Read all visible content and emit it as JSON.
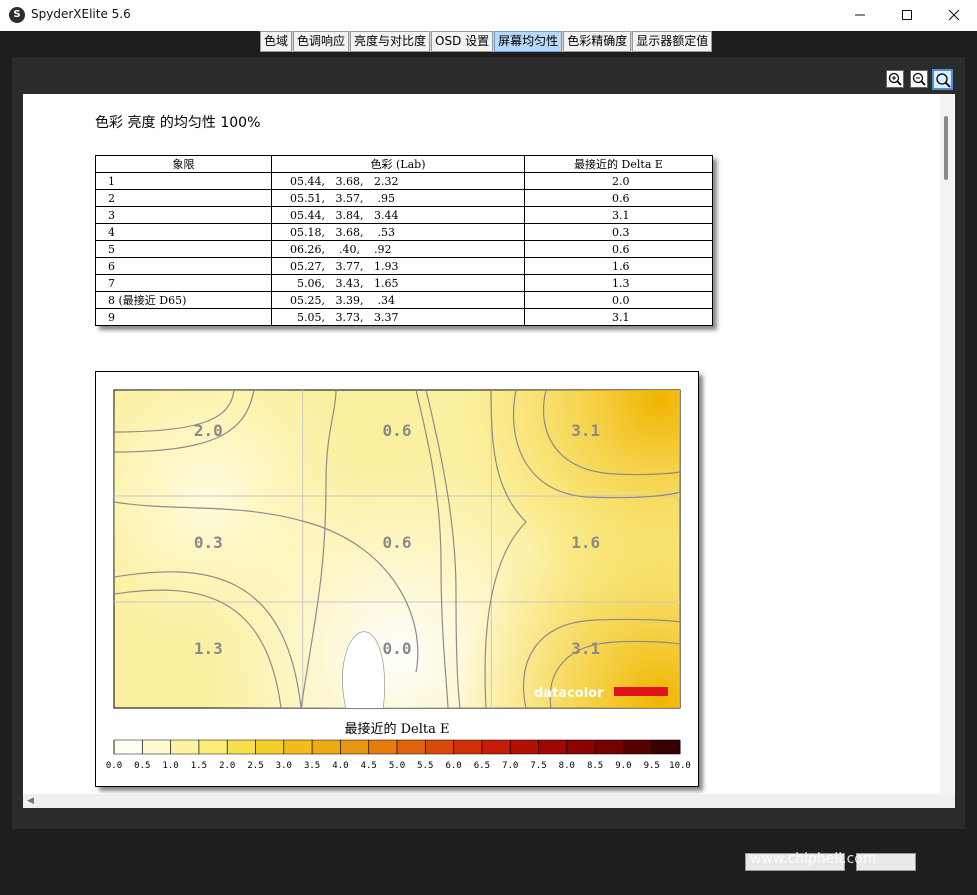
{
  "window": {
    "title": "SpyderXElite 5.6",
    "icon_letter": "S",
    "controls": [
      "minimize-icon",
      "maximize-icon",
      "close-icon"
    ]
  },
  "tabs": [
    {
      "label": "色域",
      "active": false
    },
    {
      "label": "色调响应",
      "active": false
    },
    {
      "label": "亮度与对比度",
      "active": false
    },
    {
      "label": "OSD 设置",
      "active": false
    },
    {
      "label": "屏幕均匀性",
      "active": true
    },
    {
      "label": "色彩精确度",
      "active": false
    },
    {
      "label": "显示器额定值",
      "active": false
    }
  ],
  "toolbar": {
    "icons": [
      "zoom-in-icon",
      "zoom-out-icon",
      "zoom-fit-icon"
    ]
  },
  "report": {
    "title": "色彩 亮度 的均匀性 100%",
    "table": {
      "headers": [
        "象限",
        "色彩 (Lab)",
        "最接近的 Delta E"
      ],
      "rows": [
        [
          "1",
          "05.44,   3.68,   2.32",
          "2.0"
        ],
        [
          "2",
          "05.51,   3.57,    .95",
          "0.6"
        ],
        [
          "3",
          "05.44,   3.84,   3.44",
          "3.1"
        ],
        [
          "4",
          "05.18,   3.68,    .53",
          "0.3"
        ],
        [
          "5",
          "06.26,    .40,    .92",
          "0.6"
        ],
        [
          "6",
          "05.27,   3.77,   1.93",
          "1.6"
        ],
        [
          "7",
          "  5.06,   3.43,   1.65",
          "1.3"
        ],
        [
          "8 (最接近 D65)",
          "05.25,   3.39,    .34",
          "0.0"
        ],
        [
          "9",
          "  5.05,   3.73,   3.37",
          "3.1"
        ]
      ]
    }
  },
  "chart_data": {
    "type": "heatmap",
    "title": "最接近的 Delta E",
    "grid_rows": 3,
    "grid_cols": 3,
    "cells": [
      [
        2.0,
        0.6,
        3.1
      ],
      [
        0.3,
        0.6,
        1.6
      ],
      [
        1.3,
        0.0,
        3.1
      ]
    ],
    "legend_ticks": [
      "0.0",
      "0.5",
      "1.0",
      "1.5",
      "2.0",
      "2.5",
      "3.0",
      "3.5",
      "4.0",
      "4.5",
      "5.0",
      "5.5",
      "6.0",
      "6.5",
      "7.0",
      "7.5",
      "8.0",
      "8.5",
      "9.0",
      "9.5",
      "10.0"
    ],
    "legend_colors": [
      "#fffff4",
      "#fffbcf",
      "#fdf4a3",
      "#fbec78",
      "#f8df4c",
      "#f4cf2c",
      "#f1bd1d",
      "#eeaa14",
      "#ea950f",
      "#e57c0c",
      "#df630b",
      "#d84a0a",
      "#cf3208",
      "#c21d07",
      "#b31004",
      "#a00703",
      "#8a0402",
      "#720302",
      "#560201",
      "#370101"
    ],
    "logo_text": "datacolor"
  },
  "footer": {
    "watermark": "www.chiphell.com",
    "buttons": [
      "",
      ""
    ]
  },
  "colors": {
    "active_tab": "#b8d8f8",
    "heatmap_low": "#fffff4",
    "heatmap_high": "#f0b400",
    "contour": "#8c8c8c"
  }
}
